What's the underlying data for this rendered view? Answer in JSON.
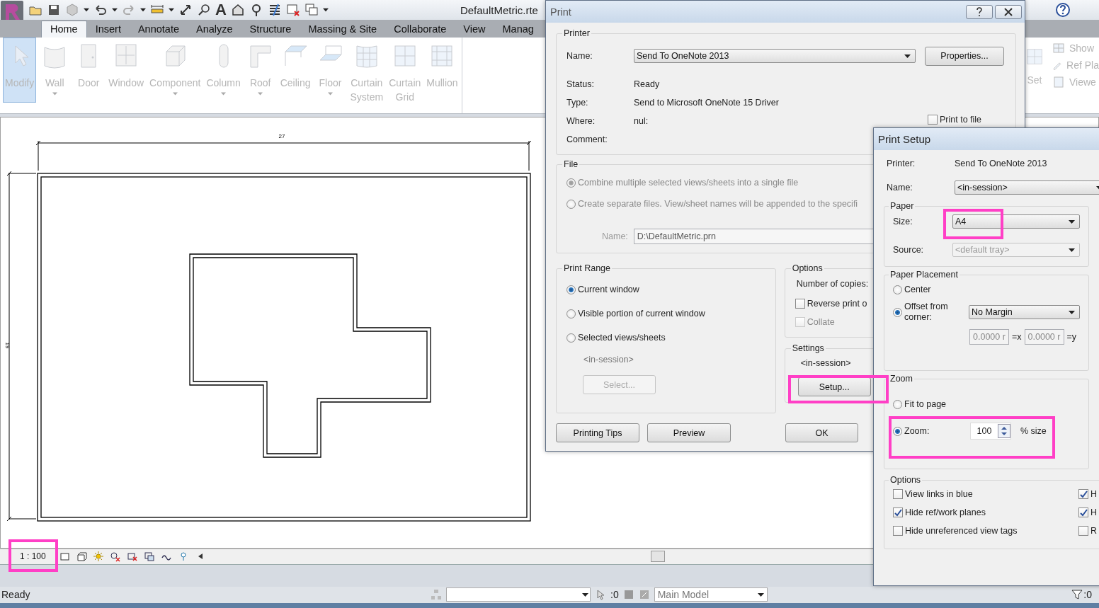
{
  "app": {
    "title": "DefaultMetric.rte",
    "text_tool": "A"
  },
  "ribbon_tabs": [
    {
      "label": "Home",
      "selected": true
    },
    {
      "label": "Insert",
      "selected": false
    },
    {
      "label": "Annotate",
      "selected": false
    },
    {
      "label": "Analyze",
      "selected": false
    },
    {
      "label": "Structure",
      "selected": false
    },
    {
      "label": "Massing & Site",
      "selected": false
    },
    {
      "label": "Collaborate",
      "selected": false
    },
    {
      "label": "View",
      "selected": false
    },
    {
      "label": "Manag",
      "selected": false
    }
  ],
  "ribbon": {
    "disabled": true,
    "tools": [
      {
        "label": "Modify",
        "selected": true,
        "dropdown": false
      },
      {
        "label": "Wall",
        "selected": false,
        "dropdown": true
      },
      {
        "label": "Door",
        "selected": false,
        "dropdown": false
      },
      {
        "label": "Window",
        "selected": false,
        "dropdown": false
      },
      {
        "label": "Component",
        "selected": false,
        "dropdown": true
      },
      {
        "label": "Column",
        "selected": false,
        "dropdown": true
      },
      {
        "label": "Roof",
        "selected": false,
        "dropdown": true
      },
      {
        "label": "Ceiling",
        "selected": false,
        "dropdown": false
      },
      {
        "label": "Floor",
        "selected": false,
        "dropdown": true
      },
      {
        "label": "Curtain System",
        "selected": false,
        "dropdown": false
      },
      {
        "label": "Curtain Grid",
        "selected": false,
        "dropdown": false
      },
      {
        "label": "Mullion",
        "selected": false,
        "dropdown": false
      }
    ],
    "partial_tool": "Set",
    "side_tools": [
      "Show",
      "Ref Pla",
      "Viewe"
    ]
  },
  "drawing": {
    "dim_horizontal": "27",
    "dim_vertical": "19"
  },
  "view_bar": {
    "scale": "1 : 100"
  },
  "status_bar": {
    "message": "Ready",
    "selection_count": ":0",
    "model": "Main Model",
    "filter_count": ":0"
  },
  "print_dialog": {
    "title": "Print",
    "printer": {
      "heading": "Printer",
      "name_label": "Name:",
      "name": "Send To OneNote 2013",
      "properties_button": "Properties...",
      "info": [
        {
          "label": "Status:",
          "value": "Ready"
        },
        {
          "label": "Type:",
          "value": "Send to Microsoft OneNote 15 Driver"
        },
        {
          "label": "Where:",
          "value": "nul:"
        },
        {
          "label": "Comment:"
        }
      ],
      "print_to_file": {
        "label": "Print to file",
        "checked": false
      }
    },
    "file": {
      "heading": "File",
      "disabled": true,
      "options": [
        {
          "label": "Combine multiple selected views/sheets into a single file",
          "selected": true
        },
        {
          "label": "Create separate files. View/sheet names will be appended to the specifi",
          "selected": false
        }
      ],
      "name_label": "Name:",
      "name": "D:\\DefaultMetric.prn"
    },
    "print_range": {
      "heading": "Print Range",
      "options": [
        {
          "label": "Current window",
          "selected": true
        },
        {
          "label": "Visible portion of current window",
          "selected": false
        },
        {
          "label": "Selected views/sheets",
          "selected": false
        }
      ],
      "set_name": "<in-session>",
      "select_button": {
        "label": "Select...",
        "disabled": true
      }
    },
    "options": {
      "heading": "Options",
      "copies_label": "Number of copies:",
      "checks": [
        {
          "label": "Reverse print o",
          "checked": false,
          "disabled": false
        },
        {
          "label": "Collate",
          "checked": false,
          "disabled": true
        }
      ]
    },
    "settings": {
      "heading": "Settings",
      "name": "<in-session>",
      "setup_button": "Setup..."
    },
    "buttons": [
      {
        "label": "Printing Tips",
        "kind": "aux"
      },
      {
        "label": "Preview",
        "kind": "aux"
      },
      {
        "label": "OK",
        "kind": "main"
      }
    ]
  },
  "print_setup": {
    "title": "Print Setup",
    "printer_label": "Printer:",
    "printer": "Send To OneNote 2013",
    "name_label": "Name:",
    "name": "<in-session>",
    "paper": {
      "heading": "Paper",
      "size_label": "Size:",
      "size": "A4",
      "source_label": "Source:",
      "source": "<default tray>",
      "source_disabled": true
    },
    "placement": {
      "heading": "Paper Placement",
      "options": [
        {
          "label": "Center",
          "selected": false
        },
        {
          "label": "Offset from corner:",
          "selected": true
        }
      ],
      "margin": "No Margin",
      "offset_x": "0.0000 r",
      "x_label": "=x",
      "offset_y": "0.0000 r",
      "y_label": "=y"
    },
    "zoom": {
      "heading": "Zoom",
      "options": [
        {
          "label": "Fit to page",
          "selected": false
        },
        {
          "label": "Zoom:",
          "selected": true
        }
      ],
      "value": "100",
      "unit": "% size"
    },
    "options": {
      "heading": "Options",
      "checks": [
        {
          "label": "View links in blue",
          "checked": false
        },
        {
          "label": "H",
          "checked": true
        },
        {
          "label": "Hide ref/work planes",
          "checked": true
        },
        {
          "label": "H",
          "checked": true
        },
        {
          "label": "Hide unreferenced view tags",
          "checked": false
        },
        {
          "label": "R",
          "checked": false
        }
      ]
    }
  }
}
